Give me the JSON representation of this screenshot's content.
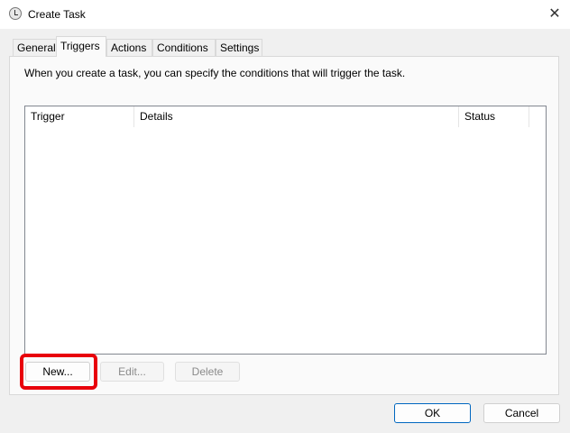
{
  "window": {
    "title": "Create Task",
    "close": "✕"
  },
  "tabs": [
    {
      "label": "General"
    },
    {
      "label": "Triggers",
      "active": true
    },
    {
      "label": "Actions"
    },
    {
      "label": "Conditions"
    },
    {
      "label": "Settings"
    }
  ],
  "triggers": {
    "description": "When you create a task, you can specify the conditions that will trigger the task.",
    "columns": [
      "Trigger",
      "Details",
      "Status"
    ],
    "rows": [],
    "buttons": {
      "new": "New...",
      "edit": "Edit...",
      "delete": "Delete"
    }
  },
  "footer": {
    "ok": "OK",
    "cancel": "Cancel"
  },
  "colors": {
    "highlight": "#e8000b",
    "accent": "#0067c0"
  }
}
